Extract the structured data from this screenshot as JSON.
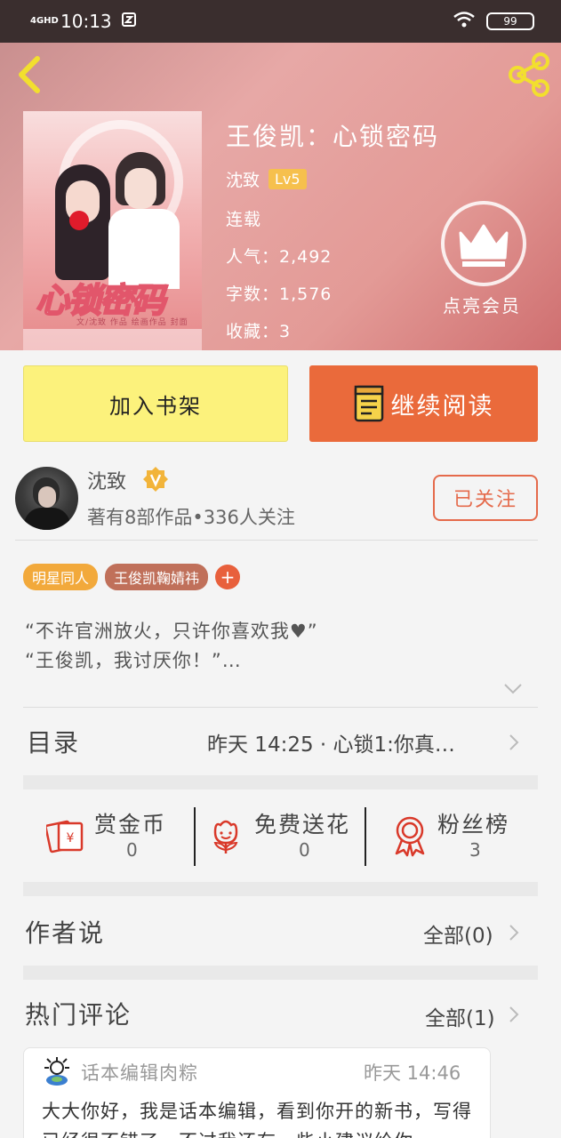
{
  "status_bar": {
    "network": "4GHD",
    "time": "10:13",
    "battery": "99"
  },
  "book": {
    "title": "王俊凯：心锁密码",
    "author": "沈致",
    "level": "Lv5",
    "status": "连载",
    "popularity": "人气：2,492",
    "word_count": "字数：1,576",
    "favorites": "收藏：3",
    "cover_title": "心锁密码",
    "cover_subtitle": "文/沈致  作品  绘画作品  封面"
  },
  "vip": {
    "label": "点亮会员"
  },
  "actions": {
    "add_to_shelf": "加入书架",
    "continue_reading": "继续阅读"
  },
  "author_card": {
    "name": "沈致",
    "meta": "著有8部作品•336人关注",
    "follow_label": "已关注"
  },
  "tags": [
    {
      "label": "明星同人",
      "color": "#f2a93b"
    },
    {
      "label": "王俊凯鞠婧祎",
      "color": "#c0705a"
    }
  ],
  "tag_add": "+",
  "intro": {
    "line1": "“不许官洲放火，只许你喜欢我♥”",
    "line2": "“王俊凯，我讨厌你！”…"
  },
  "catalog": {
    "label": "目录",
    "latest": "昨天 14:25 · 心锁1:你真…"
  },
  "rewards": [
    {
      "label": "赏金币",
      "count": "0",
      "icon": "red-envelope-icon"
    },
    {
      "label": "免费送花",
      "count": "0",
      "icon": "flower-icon"
    },
    {
      "label": "粉丝榜",
      "count": "3",
      "icon": "award-ribbon-icon"
    }
  ],
  "author_says": {
    "label": "作者说",
    "all": "全部(0)"
  },
  "hot_comments": {
    "label": "热门评论",
    "all": "全部(1)"
  },
  "comment": {
    "user": "话本编辑肉粽",
    "time": "昨天 14:46",
    "text": "大大你好，我是话本编辑，看到你开的新书，写得已经很不错了，不过我还有一些小建议给你"
  },
  "colors": {
    "accent_orange": "#ea6a3b",
    "shelf_yellow": "#fcf27c",
    "follow_red": "#e56a4b",
    "vip_gold": "#f6c04d"
  }
}
